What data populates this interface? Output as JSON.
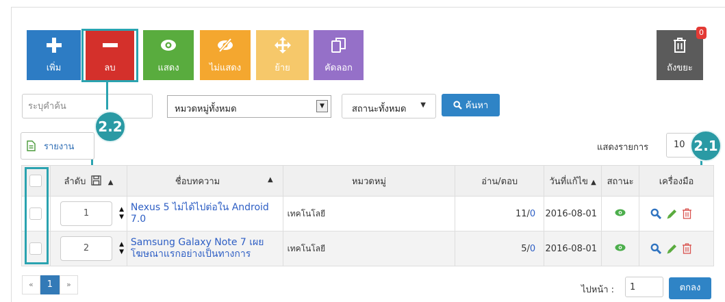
{
  "toolbar": {
    "add_label": "เพิ่ม",
    "delete_label": "ลบ",
    "show_label": "แสดง",
    "hide_label": "ไม่แสดง",
    "move_label": "ย้าย",
    "copy_label": "คัดลอก",
    "trash_label": "ถังขยะ",
    "trash_count": "0"
  },
  "filters": {
    "search_placeholder": "ระบุคำค้น",
    "category_value": "หมวดหมู่ทั้งหมด",
    "status_value": "สถานะทั้งหมด",
    "search_button": "ค้นหา"
  },
  "report_button": "รายงาน",
  "per_page": {
    "label": "แสดงรายการ",
    "value": "10"
  },
  "callouts": {
    "delete": "2.2",
    "row_delete": "2.1"
  },
  "table": {
    "headers": {
      "order": "ลำดับ",
      "title": "ชื่อบทความ",
      "category": "หมวดหมู่",
      "views": "อ่าน/ตอบ",
      "updated": "วันที่แก้ไข",
      "status": "สถานะ",
      "tools": "เครื่องมือ"
    },
    "rows": [
      {
        "order": "1",
        "title": "Nexus 5 ไม่ได้ไปต่อใน Android 7.0",
        "category": "เทคโนโลยี",
        "reads": "11",
        "replies": "0",
        "updated": "2016-08-01"
      },
      {
        "order": "2",
        "title": "Samsung Galaxy Note 7 เผยโฆษณาแรกอย่างเป็นทางการ",
        "category": "เทคโนโลยี",
        "reads": "5",
        "replies": "0",
        "updated": "2016-08-01"
      }
    ]
  },
  "pagination": {
    "prev": "«",
    "current": "1",
    "next": "»"
  },
  "goto": {
    "label": "ไปหน้า :",
    "value": "1",
    "button": "ตกลง"
  },
  "colors": {
    "add": "#2d7cc4",
    "delete": "#d4302b",
    "show": "#59ac3e",
    "hide": "#f4a72f",
    "move": "#f6c86a",
    "copy": "#9570c8",
    "trash": "#5b5b5b",
    "highlight": "#2aa3b0"
  },
  "icons": {
    "add": "plus-icon",
    "delete": "minus-icon",
    "show": "eye-icon",
    "hide": "eye-slash-icon",
    "move": "move-arrows-icon",
    "copy": "copy-icon",
    "trash": "trash-icon",
    "search": "search-icon",
    "report": "file-icon",
    "save": "save-icon",
    "view": "magnifier-icon",
    "edit": "pencil-icon",
    "delete_row": "trash-icon"
  }
}
